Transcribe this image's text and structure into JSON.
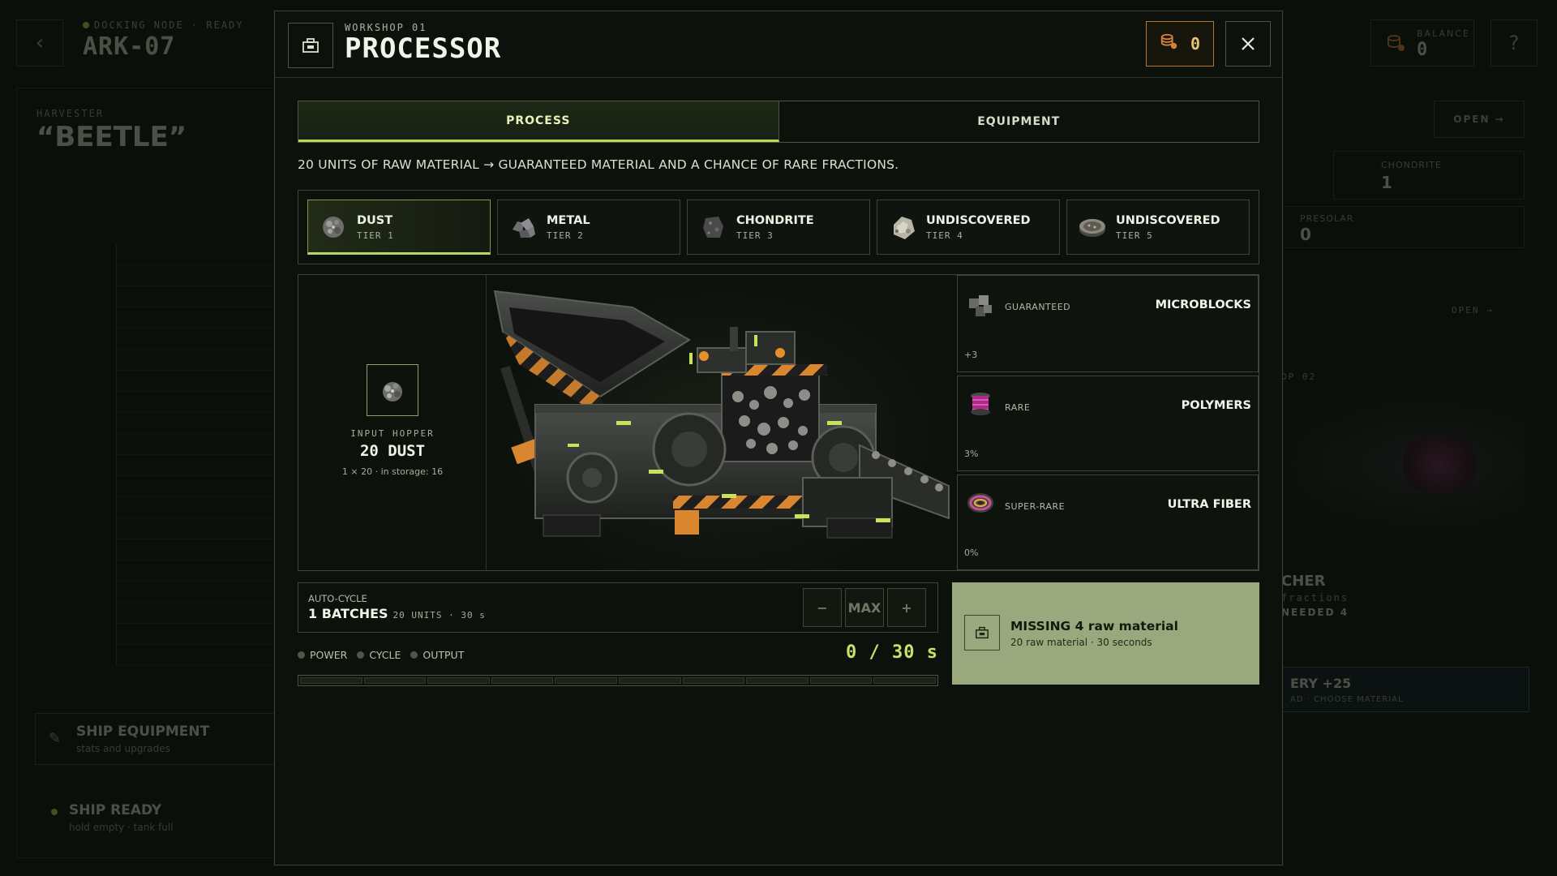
{
  "background": {
    "back_icon": "chevron-left-icon",
    "node_status": "DOCKING NODE · READY",
    "ship_name": "ARK-07",
    "balance_label": "BALANCE",
    "balance_value": "0",
    "help_label": "?",
    "harvester_label": "HARVESTER",
    "harvester_name": "“BEETLE”",
    "ship_equipment_title": "SHIP EQUIPMENT",
    "ship_equipment_sub": "stats and upgrades",
    "ship_ready_title": "SHIP READY",
    "ship_ready_sub": "hold empty · tank full",
    "open_label": "OPEN →",
    "chondrite_label": "CHONDRITE",
    "chondrite_value": "1",
    "presolar_label": "PRESOLAR",
    "presolar_value": "0",
    "open2_label": "OPEN →",
    "workshop2_label": "OP 02",
    "workshop2_title": "CHER",
    "workshop2_sub": "fractions",
    "workshop2_needed": "NEEDED 4",
    "delivery_title": "ERY +25",
    "delivery_sub": "AD · CHOOSE MATERIAL"
  },
  "modal": {
    "kicker": "WORKSHOP 01",
    "title": "PROCESSOR",
    "balance": "0",
    "tabs": [
      {
        "label": "PROCESS",
        "active": true
      },
      {
        "label": "EQUIPMENT",
        "active": false
      }
    ],
    "description": "20 UNITS OF RAW MATERIAL → GUARANTEED MATERIAL AND A CHANCE OF RARE FRACTIONS.",
    "materials": [
      {
        "name": "DUST",
        "tier": "TIER 1",
        "active": true
      },
      {
        "name": "METAL",
        "tier": "TIER 2",
        "active": false
      },
      {
        "name": "CHONDRITE",
        "tier": "TIER 3",
        "active": false
      },
      {
        "name": "UNDISCOVERED",
        "tier": "TIER 4",
        "active": false
      },
      {
        "name": "UNDISCOVERED",
        "tier": "TIER 5",
        "active": false
      }
    ],
    "hopper": {
      "label": "INPUT HOPPER",
      "value": "20 DUST",
      "sub": "1 × 20 · in storage: 16"
    },
    "outputs": [
      {
        "type": "GUARANTEED",
        "name": "MICROBLOCKS",
        "chance": "+3"
      },
      {
        "type": "RARE",
        "name": "POLYMERS",
        "chance": "3%"
      },
      {
        "type": "SUPER-RARE",
        "name": "ULTRA FIBER",
        "chance": "0%"
      }
    ],
    "cycle": {
      "label": "AUTO-CYCLE",
      "value": "1 BATCHES",
      "sub": "20 UNITS · 30 s",
      "minus": "−",
      "max": "MAX",
      "plus": "+"
    },
    "status": {
      "power": "POWER",
      "cycle": "CYCLE",
      "output": "OUTPUT"
    },
    "timer": "0 / 30 s",
    "progress": 0,
    "missing": {
      "title": "MISSING 4 raw material",
      "sub": "20 raw material · 30 seconds"
    }
  },
  "colors": {
    "accent": "#b7d960",
    "orange": "#d8813a",
    "panel_bg": "#0c110b",
    "missing_bg": "#9aa87e"
  }
}
